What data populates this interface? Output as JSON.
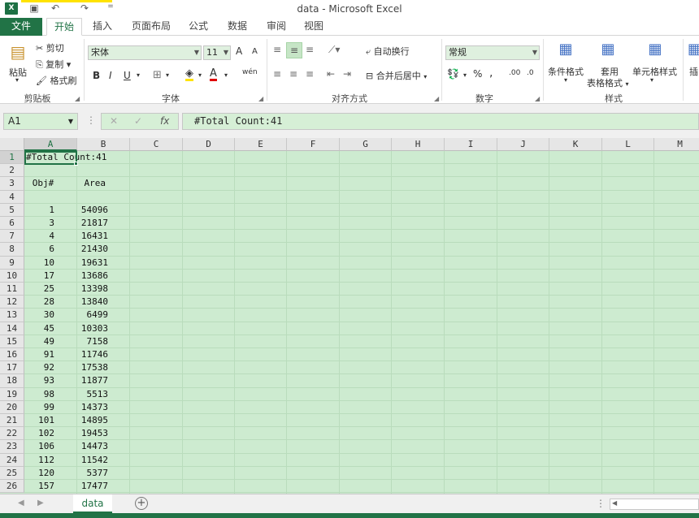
{
  "window": {
    "title": "data - Microsoft Excel",
    "logo": "X"
  },
  "quick_access": {
    "save_icon": "save-icon",
    "undo": "↶",
    "redo": "↷",
    "customize": "="
  },
  "tabs": {
    "file": "文件",
    "items": [
      "开始",
      "插入",
      "页面布局",
      "公式",
      "数据",
      "审阅",
      "视图"
    ],
    "active": "开始"
  },
  "ribbon": {
    "clipboard": {
      "label": "剪贴板",
      "paste": "粘贴",
      "cut": "剪切",
      "copy": "复制",
      "format_painter": "格式刷"
    },
    "font": {
      "label": "字体",
      "font_name": "宋体",
      "font_size": "11",
      "bold": "B",
      "italic": "I",
      "underline": "U",
      "grow": "A",
      "shrink": "A",
      "phonetic": "wén"
    },
    "alignment": {
      "label": "对齐方式",
      "wrap_text": "自动换行",
      "merge_center": "合并后居中"
    },
    "number": {
      "label": "数字",
      "format": "常规",
      "percent": "%",
      "comma": ",",
      "inc_decimal": ".00",
      "dec_decimal": ".0"
    },
    "styles": {
      "label": "样式",
      "conditional": "条件格式",
      "table_format_1": "套用",
      "table_format_2": "表格格式",
      "cell_styles": "单元格样式"
    },
    "insert_partial": "插"
  },
  "formula_bar": {
    "name_box": "A1",
    "fx": "fx",
    "content": "#Total Count:41"
  },
  "columns": [
    "A",
    "B",
    "C",
    "D",
    "E",
    "F",
    "G",
    "H",
    "I",
    "J",
    "K",
    "L",
    "M"
  ],
  "rows": [
    "1",
    "2",
    "3",
    "4",
    "5",
    "6",
    "7",
    "8",
    "9",
    "10",
    "11",
    "12",
    "13",
    "14",
    "15",
    "16",
    "17",
    "18",
    "19",
    "20",
    "21",
    "22",
    "23",
    "24",
    "25",
    "26"
  ],
  "cells": {
    "a1": "#Total Count:41",
    "header_obj": "Obj#",
    "header_area": "Area",
    "data": [
      {
        "obj": "1",
        "area": "54096"
      },
      {
        "obj": "3",
        "area": "21817"
      },
      {
        "obj": "4",
        "area": "16431"
      },
      {
        "obj": "6",
        "area": "21430"
      },
      {
        "obj": "10",
        "area": "19631"
      },
      {
        "obj": "17",
        "area": "13686"
      },
      {
        "obj": "25",
        "area": "13398"
      },
      {
        "obj": "28",
        "area": "13840"
      },
      {
        "obj": "30",
        "area": "6499"
      },
      {
        "obj": "45",
        "area": "10303"
      },
      {
        "obj": "49",
        "area": "7158"
      },
      {
        "obj": "91",
        "area": "11746"
      },
      {
        "obj": "92",
        "area": "17538"
      },
      {
        "obj": "93",
        "area": "11877"
      },
      {
        "obj": "98",
        "area": "5513"
      },
      {
        "obj": "99",
        "area": "14373"
      },
      {
        "obj": "101",
        "area": "14895"
      },
      {
        "obj": "102",
        "area": "19453"
      },
      {
        "obj": "106",
        "area": "14473"
      },
      {
        "obj": "112",
        "area": "11542"
      },
      {
        "obj": "120",
        "area": "5377"
      },
      {
        "obj": "157",
        "area": "17477"
      }
    ]
  },
  "sheet_tabs": {
    "active": "data",
    "add": "+"
  },
  "colors": {
    "accent": "#217346",
    "sheet_bg": "#cdebd0"
  }
}
